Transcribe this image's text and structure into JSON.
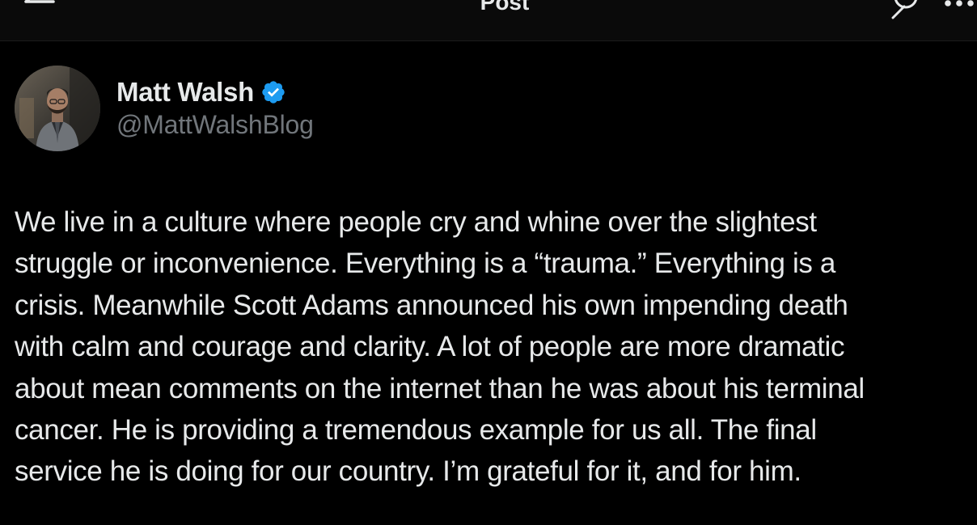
{
  "header": {
    "title": "Post",
    "back_icon": "arrow-left-icon",
    "grok_icon": "grok-icon",
    "more_icon": "more-horizontal-icon"
  },
  "author": {
    "name": "Matt Walsh",
    "handle": "@MattWalshBlog",
    "verified": true,
    "verified_color": "#1d9bf0"
  },
  "post": {
    "lines": [
      "We live in a culture where people cry and whine over the slightest",
      "struggle or inconvenience. Everything is a “trauma.” Everything is a",
      "crisis. Meanwhile Scott Adams announced his own impending death",
      "with calm and courage and clarity. A lot of people are more dramatic",
      "about mean comments on the internet than he was about his terminal",
      "cancer. He is providing a tremendous example for us all. The final",
      "service he is doing for our country. I’m grateful for it, and for him."
    ]
  },
  "colors": {
    "background": "#000000",
    "text_primary": "#e7e9ea",
    "text_secondary": "#71767b",
    "accent": "#1d9bf0"
  }
}
